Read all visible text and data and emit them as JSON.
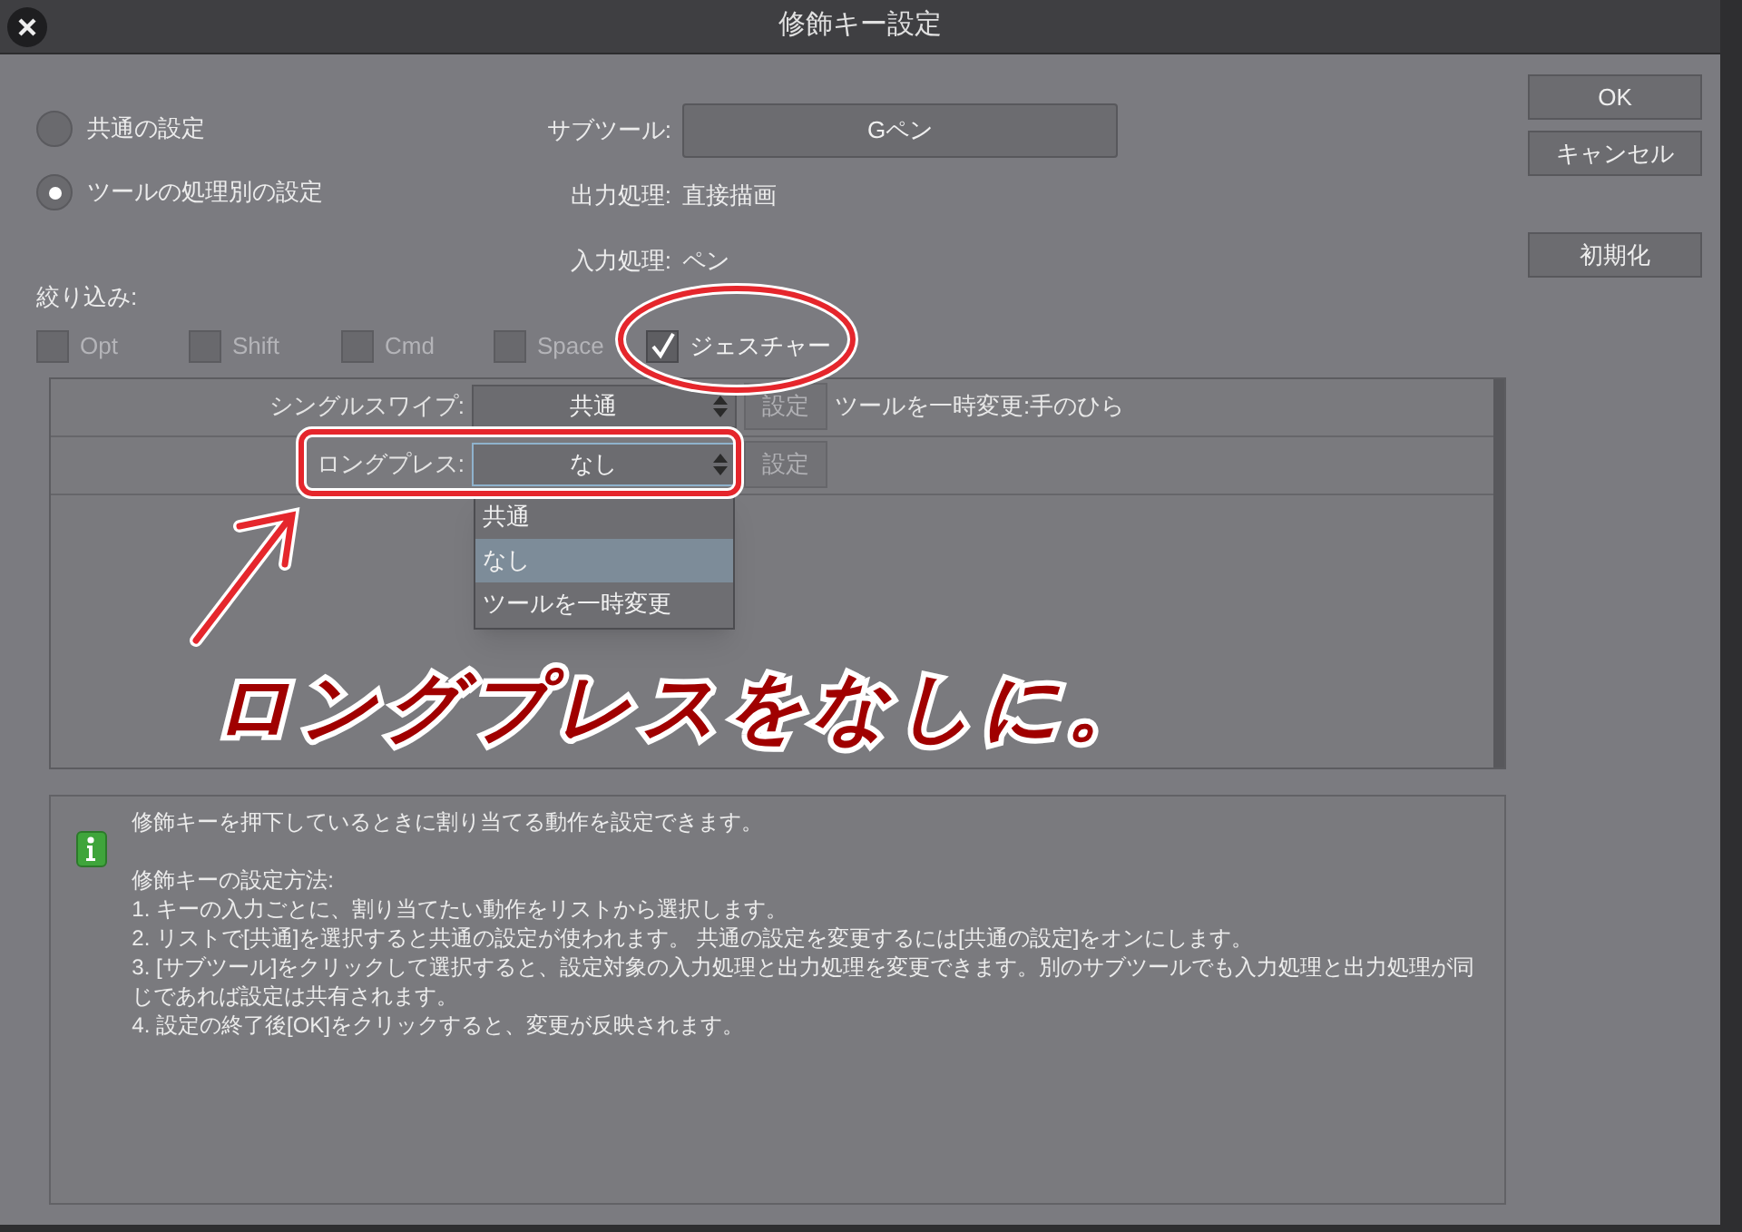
{
  "window": {
    "title": "修飾キー設定"
  },
  "scope_options": [
    {
      "label": "共通の設定",
      "selected": false
    },
    {
      "label": "ツールの処理別の設定",
      "selected": true
    }
  ],
  "subtool": {
    "label": "サブツール:",
    "value": "Gペン"
  },
  "output_process": {
    "label": "出力処理:",
    "value": "直接描画"
  },
  "input_process": {
    "label": "入力処理:",
    "value": "ペン"
  },
  "filter": {
    "label": "絞り込み:",
    "options": [
      {
        "label": "Opt",
        "checked": false,
        "disabled": true
      },
      {
        "label": "Shift",
        "checked": false,
        "disabled": true
      },
      {
        "label": "Cmd",
        "checked": false,
        "disabled": true
      },
      {
        "label": "Space",
        "checked": false,
        "disabled": true
      },
      {
        "label": "ジェスチャー",
        "checked": true,
        "disabled": false
      }
    ]
  },
  "rows": [
    {
      "label": "シングルスワイプ:",
      "value": "共通",
      "button": "設定",
      "description": "ツールを一時変更:手のひら",
      "focused": false
    },
    {
      "label": "ロングプレス:",
      "value": "なし",
      "button": "設定",
      "focused": true
    }
  ],
  "dropdown": {
    "options": [
      {
        "label": "共通",
        "selected": false
      },
      {
        "label": "なし",
        "selected": true
      },
      {
        "label": "ツールを一時変更",
        "selected": false
      }
    ]
  },
  "info": {
    "intro": "修飾キーを押下しているときに割り当てる動作を設定できます。",
    "lines": [
      "修飾キーの設定方法:",
      "1. キーの入力ごとに、割り当てたい動作をリストから選択します。",
      "2. リストで[共通]を選択すると共通の設定が使われます。 共通の設定を変更するには[共通の設定]をオンにします。",
      "3. [サブツール]をクリックして選択すると、設定対象の入力処理と出力処理を変更できます。別のサブツールでも入力処理と出力処理が同じであれば設定は共有されます。",
      "4. 設定の終了後[OK]をクリックすると、変更が反映されます。"
    ]
  },
  "buttons": [
    "OK",
    "キャンセル",
    "初期化"
  ],
  "annotation": {
    "text": "ロングプレスをなしに。"
  }
}
